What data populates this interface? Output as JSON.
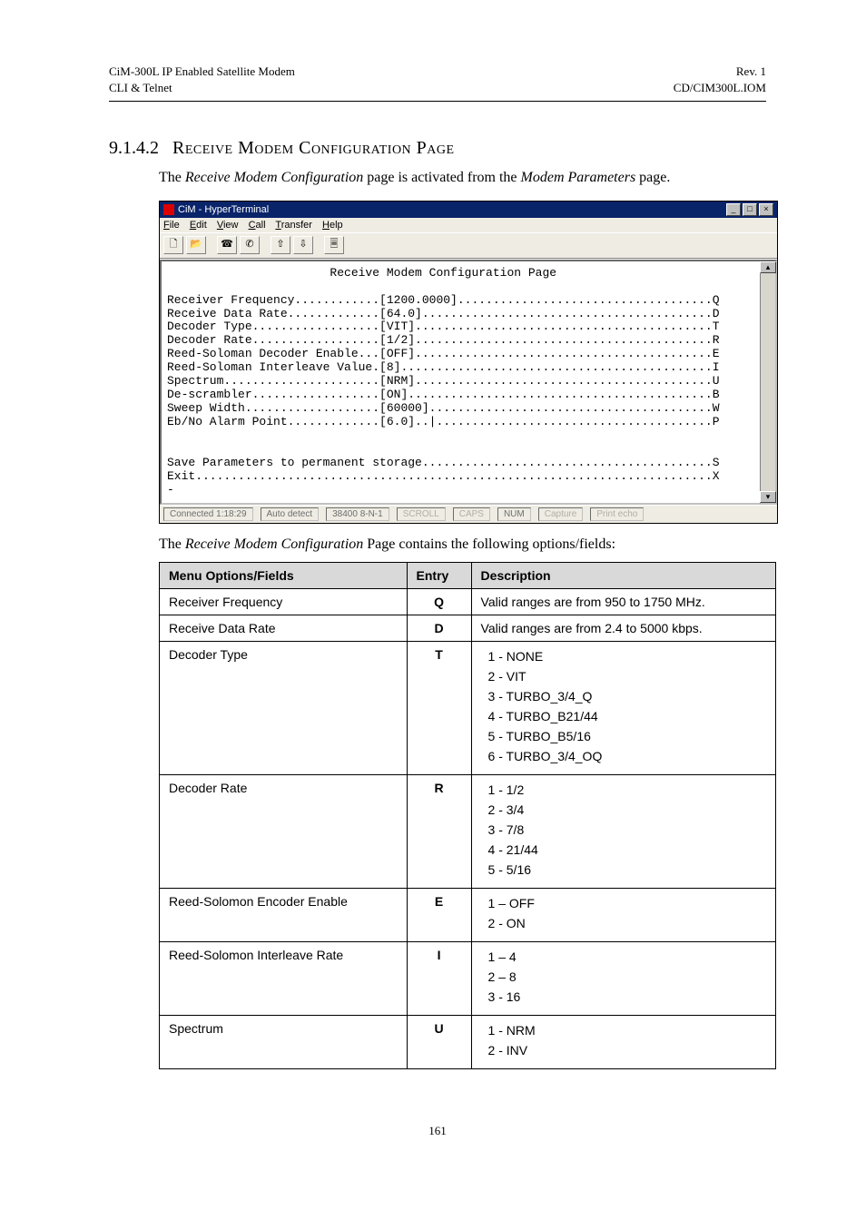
{
  "header": {
    "left_line1": "CiM-300L IP Enabled Satellite Modem",
    "left_line2": "CLI & Telnet",
    "right_line1": "Rev. 1",
    "right_line2": "CD/CIM300L.IOM"
  },
  "section": {
    "number": "9.1.4.2",
    "title": "Receive Modem Configuration Page"
  },
  "intro_parts": {
    "a": "The ",
    "b": "Receive Modem Configuration",
    "c": " page is activated from the ",
    "d": "Modem Parameters",
    "e": " page."
  },
  "hyperterminal": {
    "title": "CiM - HyperTerminal",
    "menus": [
      "File",
      "Edit",
      "View",
      "Call",
      "Transfer",
      "Help"
    ],
    "toolbar_icons": [
      "new-file-icon",
      "open-file-icon",
      "tb-sep",
      "call-icon",
      "hangup-icon",
      "tb-sep",
      "send-icon",
      "receive-icon",
      "tb-sep",
      "properties-icon"
    ],
    "terminal": {
      "title": "Receive Modem Configuration Page",
      "lines": [
        {
          "label": "Receiver Frequency",
          "value": "1200.0000",
          "key": "Q"
        },
        {
          "label": "Receive Data Rate",
          "value": "64.0",
          "key": "D"
        },
        {
          "label": "Decoder Type",
          "value": "VIT",
          "key": "T"
        },
        {
          "label": "Decoder Rate",
          "value": "1/2",
          "key": "R"
        },
        {
          "label": "Reed-Soloman Decoder Enable",
          "value": "OFF",
          "key": "E"
        },
        {
          "label": "Reed-Soloman Interleave Value",
          "value": "8",
          "key": "I"
        },
        {
          "label": "Spectrum",
          "value": "NRM",
          "key": "U"
        },
        {
          "label": "De-scrambler",
          "value": "ON",
          "key": "B"
        },
        {
          "label": "Sweep Width",
          "value": "60000",
          "key": "W"
        },
        {
          "label": "Eb/No Alarm Point",
          "value": "6.0",
          "key": "P",
          "cursor": true
        }
      ],
      "footer_lines": [
        {
          "label": "Save Parameters to permanent storage",
          "key": "S"
        },
        {
          "label": "Exit",
          "key": "X"
        }
      ],
      "prompt": "-"
    },
    "status": {
      "conn": "Connected 1:18:29",
      "detect": "Auto detect",
      "params": "38400 8-N-1",
      "flags": [
        "SCROLL",
        "CAPS",
        "NUM",
        "Capture",
        "Print echo"
      ]
    }
  },
  "after_parts": {
    "a": "The ",
    "b": "Receive Modem Configuration",
    "c": " Page  contains the following options/fields:"
  },
  "table": {
    "headers": {
      "c1": "Menu Options/Fields",
      "c2": "Entry",
      "c3": "Description"
    },
    "rows": [
      {
        "field": "Receiver Frequency",
        "entry": "Q",
        "desc": [
          "Valid ranges are from 950 to 1750 MHz."
        ]
      },
      {
        "field": "Receive Data Rate",
        "entry": "D",
        "desc": [
          "Valid ranges are from 2.4 to 5000 kbps."
        ]
      },
      {
        "field": "Decoder Type",
        "entry": "T",
        "desc": [
          "1 - NONE",
          "2 - VIT",
          "3 - TURBO_3/4_Q",
          "4 - TURBO_B21/44",
          "5 - TURBO_B5/16",
          "6 - TURBO_3/4_OQ"
        ]
      },
      {
        "field": "Decoder Rate",
        "entry": "R",
        "desc": [
          "1 - 1/2",
          "2 - 3/4",
          "3 - 7/8",
          "4 - 21/44",
          "5 - 5/16"
        ]
      },
      {
        "field": "Reed-Solomon Encoder Enable",
        "entry": "E",
        "desc": [
          "1 – OFF",
          "2 - ON"
        ]
      },
      {
        "field": "Reed-Solomon Interleave Rate",
        "entry": "I",
        "desc": [
          "1 – 4",
          "2 – 8",
          "3 - 16"
        ]
      },
      {
        "field": "Spectrum",
        "entry": "U",
        "desc": [
          "1 - NRM",
          "2 - INV"
        ]
      }
    ]
  },
  "page_number": "161"
}
